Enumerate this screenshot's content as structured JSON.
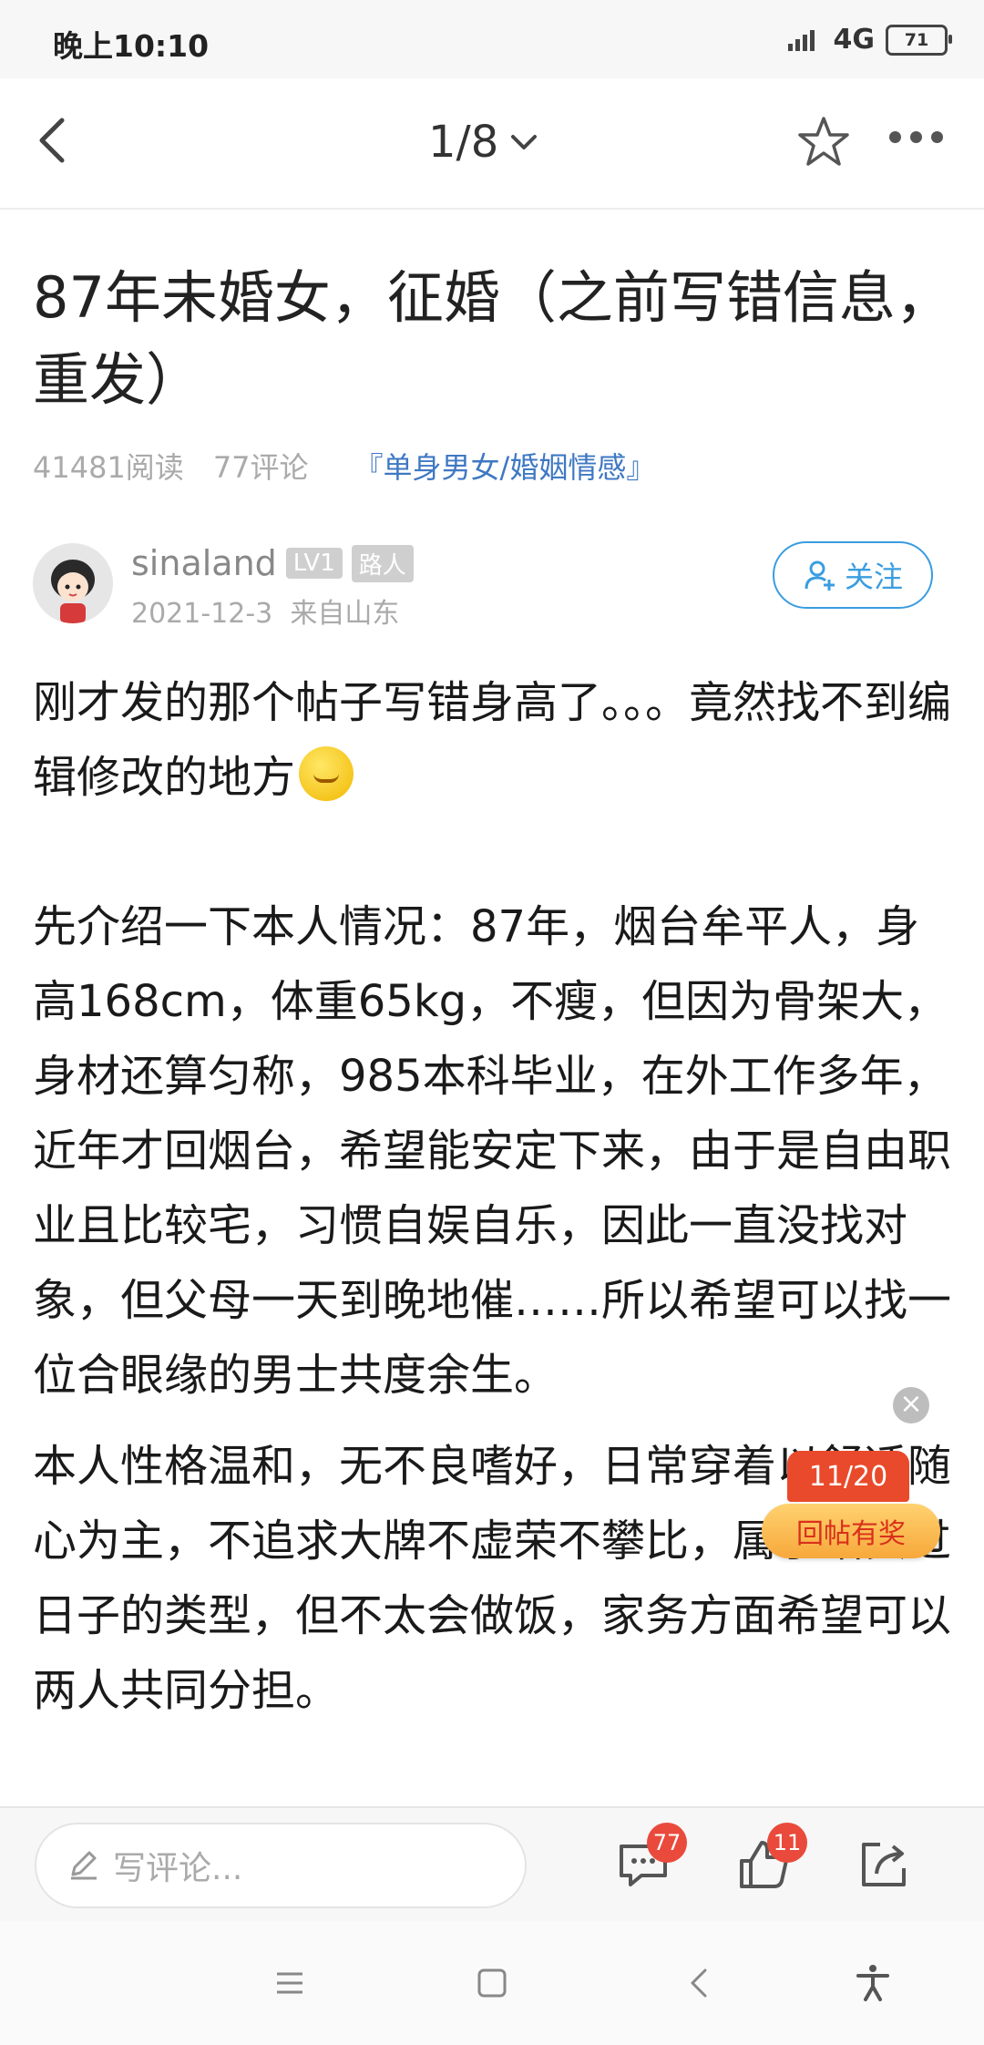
{
  "status_bar": {
    "time": "晚上10:10",
    "network": "4G",
    "battery": "71"
  },
  "nav": {
    "pager": "1/8"
  },
  "post": {
    "title": "87年未婚女，征婚（之前写错信息，重发）",
    "reads": "41481阅读",
    "comments": "77评论",
    "category": "『单身男女/婚姻情感』",
    "author": {
      "name": "sinaland",
      "level": "LV1",
      "rank": "路人",
      "date": "2021-12-3",
      "location": "来自山东",
      "follow_label": "关注"
    },
    "paragraphs": {
      "p1": "刚才发的那个帖子写错身高了。。。竟然找不到编辑修改的地方",
      "p2": "先介绍一下本人情况：87年，烟台牟平人，身高168cm，体重65kg，不瘦，但因为骨架大，身材还算匀称，985本科毕业，在外工作多年，近年才回烟台，希望能安定下来，由于是自由职业且比较宅，习惯自娱自乐，因此一直没找对象，但父母一天到晚地催……所以希望可以找一位合眼缘的男士共度余生。",
      "p3": "本人性格温和，无不良嗜好，日常穿着以舒适随心为主，不追求大牌不虚荣不攀比，属于踏实过日子的类型，但不太会做饭，家务方面希望可以两人共同分担。"
    }
  },
  "reward": {
    "count": "11/20",
    "label": "回帖有奖"
  },
  "actionbar": {
    "comment_placeholder": "写评论...",
    "comment_count": "77",
    "like_count": "11"
  },
  "colors": {
    "accent_blue": "#3a9de0",
    "category_blue": "#3f78c3",
    "badge_red": "#e94a3b"
  }
}
